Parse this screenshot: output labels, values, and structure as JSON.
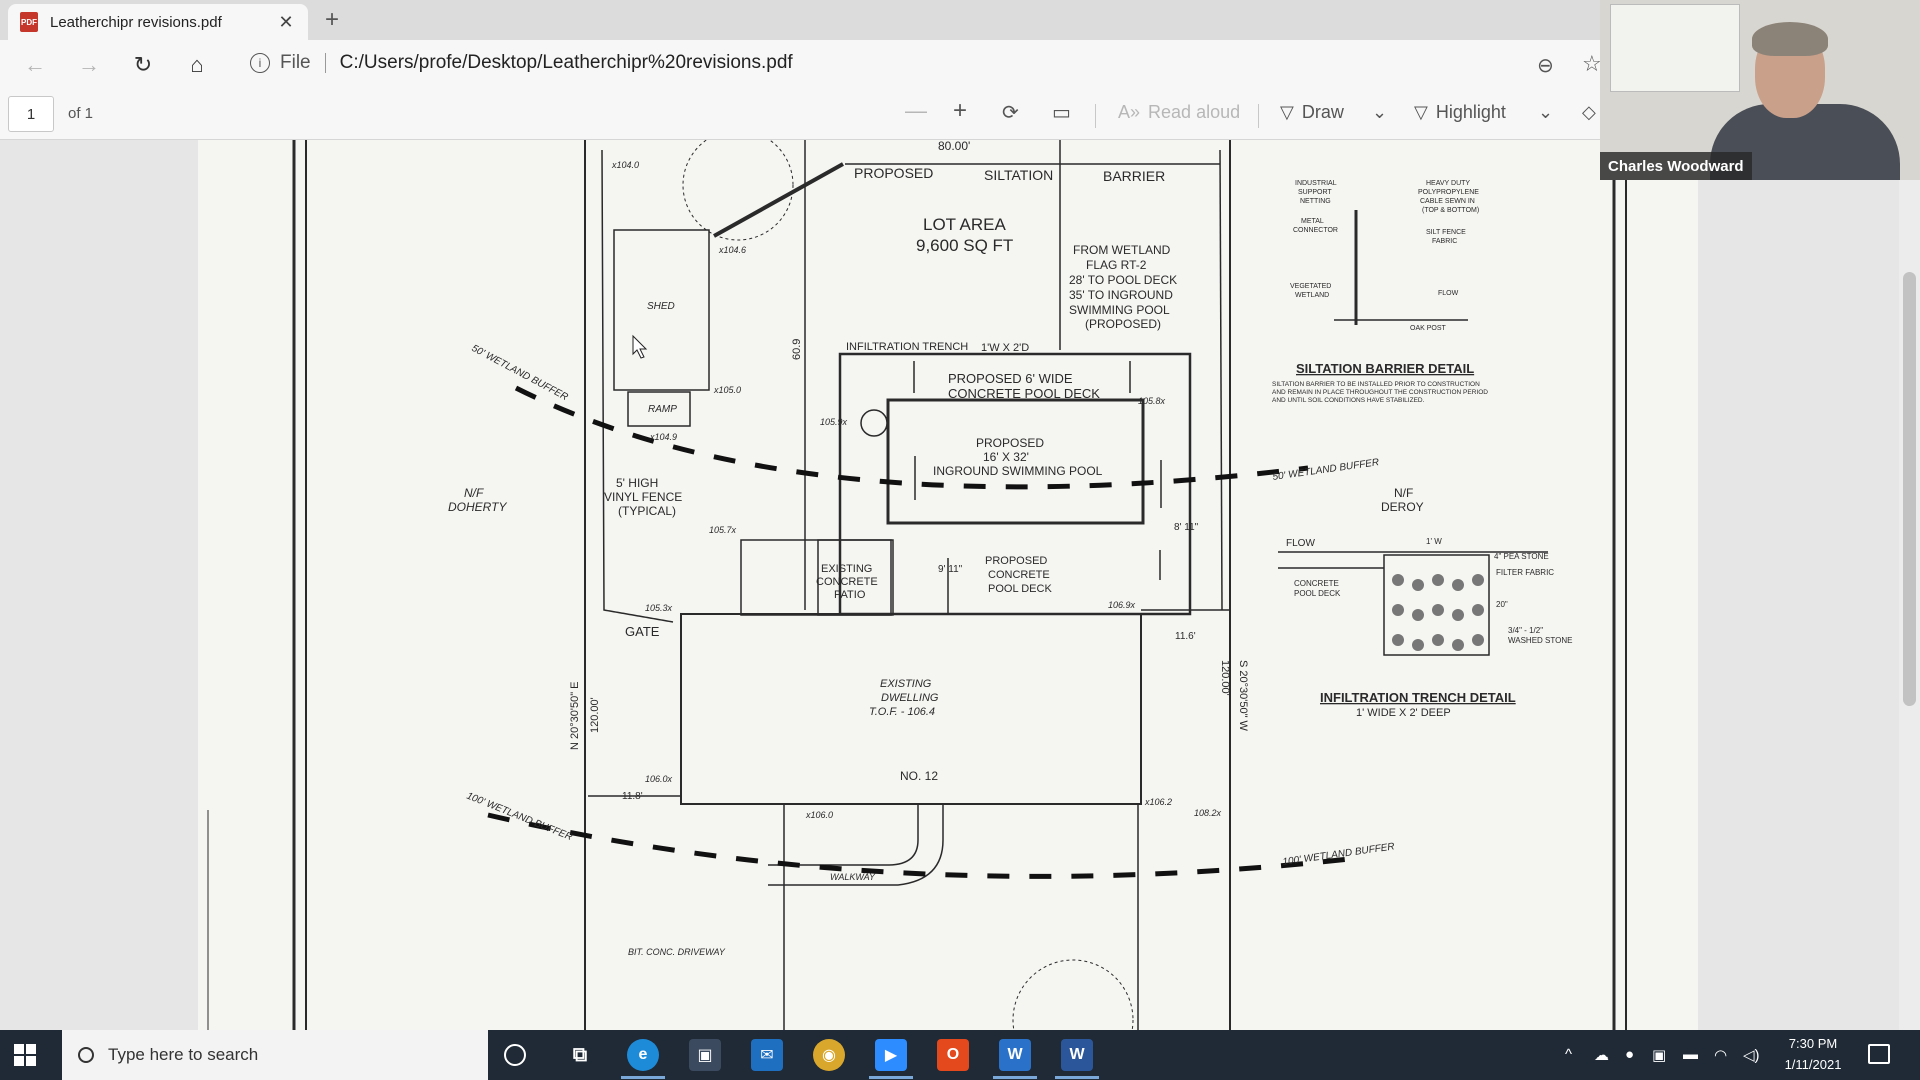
{
  "browser": {
    "tab_title": "Leatherchipr revisions.pdf",
    "url_scheme": "File",
    "url": "C:/Users/profe/Desktop/Leatherchipr%20revisions.pdf"
  },
  "pdf_toolbar": {
    "page_number": "1",
    "page_of": "of 1",
    "read_aloud": "Read aloud",
    "draw": "Draw",
    "highlight": "Highlight"
  },
  "video": {
    "participant_name": "Charles Woodward"
  },
  "taskbar": {
    "search_placeholder": "Type here to search",
    "time": "7:30 PM",
    "date": "1/11/2021"
  },
  "plan": {
    "proposed": "PROPOSED",
    "siltation": "SILTATION",
    "barrier": "BARRIER",
    "lot_area": "LOT AREA",
    "lot_sqft": "9,600 SQ FT",
    "dim_top": "80.00'",
    "from_wetland_1": "FROM WETLAND",
    "from_wetland_2": "FLAG RT-2",
    "from_wetland_3": "28' TO POOL DECK",
    "from_wetland_4": "35' TO INGROUND",
    "from_wetland_5": "SWIMMING POOL",
    "from_wetland_6": "(PROPOSED)",
    "shed": "SHED",
    "ramp": "RAMP",
    "wetland_buffer_50": "50' WETLAND BUFFER",
    "wetland_buffer_50b": "50' WETLAND BUFFER",
    "infiltration_trench": "INFILTRATION TRENCH",
    "trench_size": "1'W X 2'D",
    "pool_deck_1": "PROPOSED 6' WIDE",
    "pool_deck_2": "CONCRETE POOL DECK",
    "pool_1": "PROPOSED",
    "pool_2": "16' X 32'",
    "pool_3": "INGROUND SWIMMING POOL",
    "fence_1": "5' HIGH",
    "fence_2": "VINYL FENCE",
    "fence_3": "(TYPICAL)",
    "nf_doherty_1": "N/F",
    "nf_doherty_2": "DOHERTY",
    "nf_deroy_1": "N/F",
    "nf_deroy_2": "DEROY",
    "patio_1": "EXISTING",
    "patio_2": "CONCRETE",
    "patio_3": "PATIO",
    "deck2_1": "PROPOSED",
    "deck2_2": "CONCRETE",
    "deck2_3": "POOL DECK",
    "gate": "GATE",
    "dwelling_1": "EXISTING",
    "dwelling_2": "DWELLING",
    "dwelling_3": "T.O.F. - 106.4",
    "house_no": "NO. 12",
    "walkway": "WALKWAY",
    "driveway": "BIT. CONC. DRIVEWAY",
    "wetland_buffer_100": "100' WETLAND BUFFER",
    "wetland_buffer_100b": "100' WETLAND BUFFER",
    "bearing_left": "N 20°30'50\" E",
    "bearing_right": "S 20°30'50\" W",
    "dim_120_left": "120.00'",
    "dim_120_right": "120.00'",
    "dim_60": "60.9",
    "dim_11_6": "11.6'",
    "dim_11_8": "11.8'",
    "dim_9_11": "9' 11\"",
    "dim_8_11": "8' 11\"",
    "elev_104_0": "x104.0",
    "elev_104_6": "x104.6",
    "elev_105_0": "x105.0",
    "elev_104_9": "x104.9",
    "elev_105_9": "105.9x",
    "elev_105_8": "105.8x",
    "elev_105_7": "105.7x",
    "elev_105_3": "105.3x",
    "elev_106_0": "106.0x",
    "elev_106_8": "x106.0",
    "elev_106_2": "x106.2",
    "elev_108_2": "108.2x",
    "elev_106_9": "106.9x",
    "siltation_detail_title": "SILTATION BARRIER DETAIL",
    "siltation_detail_note_1": "SILTATION BARRIER TO BE INSTALLED PRIOR TO CONSTRUCTION",
    "siltation_detail_note_2": "AND REMAIN IN PLACE THROUGHOUT THE CONSTRUCTION PERIOD",
    "siltation_detail_note_3": "AND UNTIL SOIL CONDITIONS HAVE STABILIZED.",
    "sd_industrial": "INDUSTRIAL",
    "sd_support": "SUPPORT",
    "sd_netting": "NETTING",
    "sd_heavy_duty": "HEAVY DUTY",
    "sd_polypropylene": "POLYPROPYLENE",
    "sd_cable": "CABLE SEWN IN",
    "sd_top_bottom": "(TOP & BOTTOM)",
    "sd_metal": "METAL",
    "sd_connector": "CONNECTOR",
    "sd_silt_fence": "SILT FENCE",
    "sd_fabric": "FABRIC",
    "sd_vegetated": "VEGETATED",
    "sd_wetland": "WETLAND",
    "sd_flow": "FLOW",
    "sd_oak_post": "OAK POST",
    "it_flow": "FLOW",
    "it_1w": "1' W",
    "it_pea": "4\" PEA STONE",
    "it_filter": "FILTER FABRIC",
    "it_concrete": "CONCRETE",
    "it_pool_deck": "POOL DECK",
    "it_20": "20\"",
    "it_washed_1": "3/4\" - 1/2\"",
    "it_washed_2": "WASHED STONE",
    "infiltration_detail_title": "INFILTRATION TRENCH DETAIL",
    "infiltration_detail_sub": "1' WIDE  X  2' DEEP"
  },
  "colors": {
    "ink": "#2a2a2a",
    "page": "#f5f5f2",
    "taskbar": "#1f2a36",
    "pdf_icon": "#c5362b"
  }
}
